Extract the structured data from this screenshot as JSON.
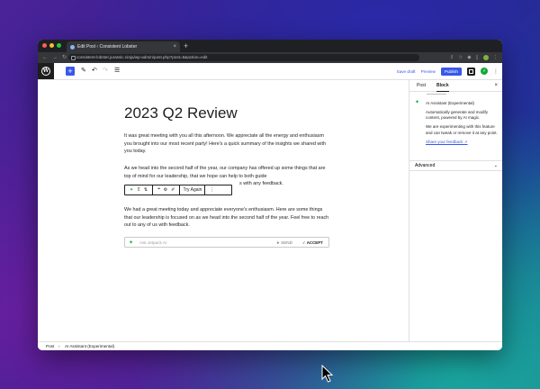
{
  "browser": {
    "tab_title": "Edit Post ‹ Consistent Lobster",
    "new_tab": "+",
    "url": "consistent-lobster.jurassic.ninja/wp-admin/post.php?post=5&action=edit",
    "traffic_colors": [
      "#ff5f57",
      "#febc2e",
      "#28c840"
    ]
  },
  "toolbar": {
    "save_draft": "Save draft",
    "preview": "Preview",
    "publish": "Publish",
    "add_block": "+"
  },
  "post": {
    "title": "2023 Q2 Review",
    "paragraphs": [
      "It was great meeting with you all this afternoon. We appreciate all the energy and enthusiasm you brought into our most recent party! Here's a quick summary of the insights we shared with you today.",
      "As we head into the second half of the year, our company has offered up some things that are top of mind for our leadership, that we hope can help to both guide",
      "s with any feedback.",
      "We had a great meeting today and appreciate everyone's enthusiasm. Here are some things that our leadership is focused on as we head into the second half of the year. Feel free to reach out to any of us with feedback."
    ]
  },
  "block_toolbar": {
    "try_again": "Try Again"
  },
  "ai_prompt": {
    "placeholder": "Ask Jetpack AI",
    "send": "SEND",
    "accept": "ACCEPT"
  },
  "sidebar": {
    "tab_post": "Post",
    "tab_block": "Block",
    "close": "×",
    "block_title": "AI Assistant (Experimental)",
    "description": "Automatically generate and modify content, powered by AI magic.",
    "experimental_note": "We are experimenting with this feature and can tweak or remove it at any point.",
    "feedback_link": "Share your feedback ↗",
    "advanced": "Advanced"
  },
  "breadcrumb": {
    "post": "Post",
    "separator": "›",
    "block": "AI Assistant (Experimental)"
  },
  "colors": {
    "wp_blue": "#3858e9",
    "ai_green": "#14a838",
    "dark": "#1e1e1e"
  }
}
